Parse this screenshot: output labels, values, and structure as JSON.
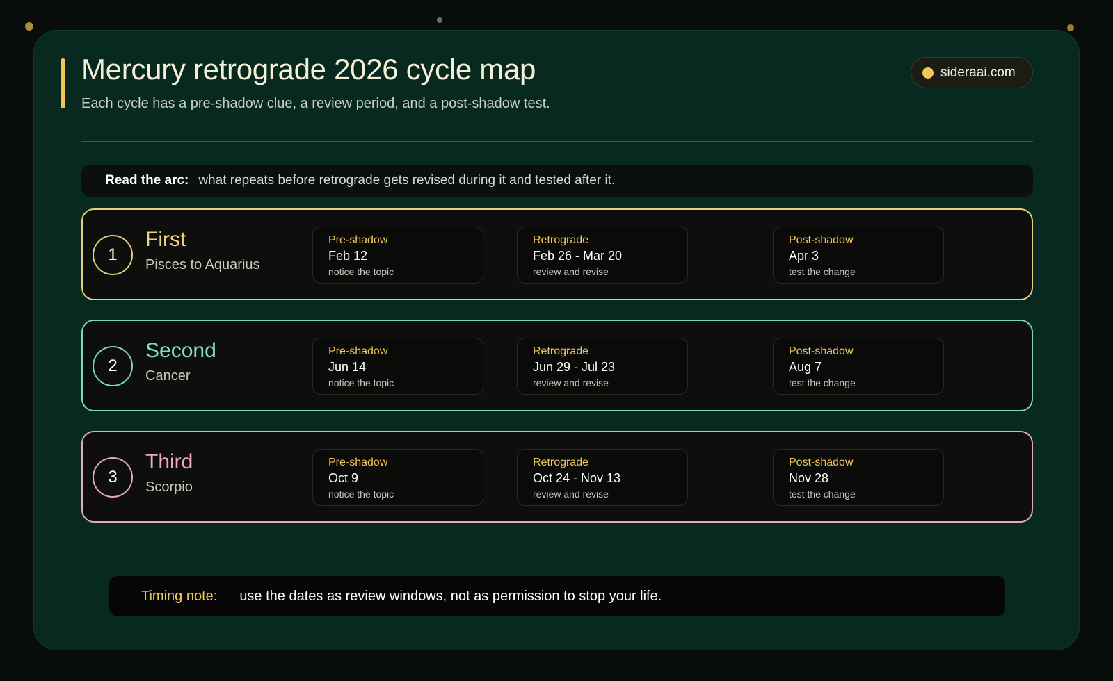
{
  "header": {
    "title": "Mercury retrograde 2026 cycle map",
    "subtitle": "Each cycle has a pre-shadow clue, a review period, and a post-shadow test.",
    "site": "sideraai.com"
  },
  "arc": {
    "label": "Read the arc:",
    "text": "what repeats before retrograde gets revised during it and tested after it."
  },
  "cycles": [
    {
      "number": "1",
      "name": "First",
      "sign": "Pisces to Aquarius",
      "color": "#e6cf7d",
      "phases": [
        {
          "label": "Pre-shadow",
          "date": "Feb 12",
          "note": "notice the topic"
        },
        {
          "label": "Retrograde",
          "date": "Feb 26 - Mar 20",
          "note": "review and revise"
        },
        {
          "label": "Post-shadow",
          "date": "Apr 3",
          "note": "test the change"
        }
      ]
    },
    {
      "number": "2",
      "name": "Second",
      "sign": "Cancer",
      "color": "#7ad9bb",
      "phases": [
        {
          "label": "Pre-shadow",
          "date": "Jun 14",
          "note": "notice the topic"
        },
        {
          "label": "Retrograde",
          "date": "Jun 29 - Jul 23",
          "note": "review and revise"
        },
        {
          "label": "Post-shadow",
          "date": "Aug 7",
          "note": "test the change"
        }
      ]
    },
    {
      "number": "3",
      "name": "Third",
      "sign": "Scorpio",
      "color": "#e3a9be",
      "phases": [
        {
          "label": "Pre-shadow",
          "date": "Oct 9",
          "note": "notice the topic"
        },
        {
          "label": "Retrograde",
          "date": "Oct 24 - Nov 13",
          "note": "review and revise"
        },
        {
          "label": "Post-shadow",
          "date": "Nov 28",
          "note": "test the change"
        }
      ]
    }
  ],
  "timing": {
    "label": "Timing note:",
    "text": "use the dates as review windows, not as permission to stop your life."
  },
  "colors": {
    "accent": "#f2c75a",
    "background": "#07291f"
  }
}
